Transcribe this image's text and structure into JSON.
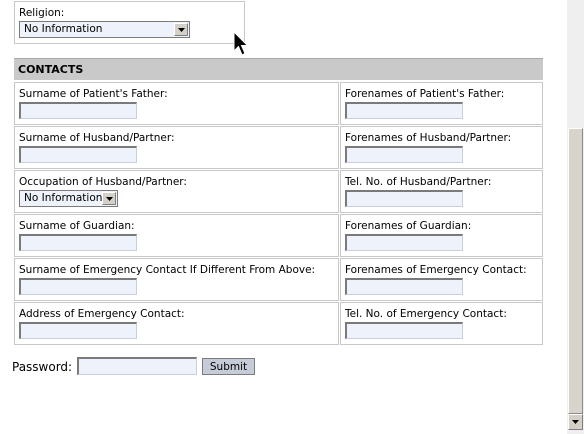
{
  "religion": {
    "label": "Religion:",
    "selected": "No Information"
  },
  "section_title": "CONTACTS",
  "fields": {
    "father_surname": "Surname of Patient's Father:",
    "father_forenames": "Forenames of Patient's Father:",
    "partner_surname": "Surname of Husband/Partner:",
    "partner_forenames": "Forenames of Husband/Partner:",
    "partner_occupation": "Occupation of Husband/Partner:",
    "partner_occupation_selected": "No Information",
    "partner_tel": "Tel. No. of Husband/Partner:",
    "guardian_surname": "Surname of Guardian:",
    "guardian_forenames": "Forenames of Guardian:",
    "emergency_surname": "Surname of Emergency Contact If Different From Above:",
    "emergency_forenames": "Forenames of Emergency Contact:",
    "emergency_address": "Address of Emergency Contact:",
    "emergency_tel": "Tel. No. of Emergency Contact:"
  },
  "password": {
    "label": "Password:",
    "value": ""
  },
  "submit_label": "Submit",
  "icons": {
    "dropdown": "chevron-down-icon",
    "cursor": "mouse-pointer-icon",
    "scroll_down": "scroll-down-arrow-icon"
  }
}
